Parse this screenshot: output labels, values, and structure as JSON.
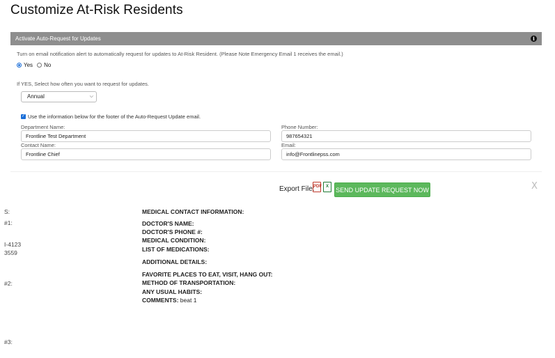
{
  "page": {
    "title": "Customize At-Risk Residents"
  },
  "section": {
    "title": "Activate Auto-Request for Updates",
    "info_icon": "i"
  },
  "notice": "Turn on email notification alert to automatically request for updates to At-Risk Resident. (Please Note Emergency Email 1 receives the email.)",
  "radio": {
    "yes": "Yes",
    "no": "No",
    "selected": "Yes"
  },
  "frequency": {
    "label": "If YES, Select how often you want to request for updates.",
    "selected": "Annual"
  },
  "footer_option": {
    "label": "Use the information below for the footer of the Auto-Request Update email.",
    "checked": true
  },
  "fields": {
    "department_label": "Department Name:",
    "department_value": "Frontline Test Department",
    "phone_label": "Phone Number:",
    "phone_value": "987654321",
    "contact_label": "Contact Name:",
    "contact_value": "Frontline Chief",
    "email_label": "Email:",
    "email_value": "info@Frontlinepss.com"
  },
  "export": {
    "label": "Export File:",
    "pdf": "PDF",
    "xls": "X",
    "send_button": "SEND UPDATE REQUEST NOW",
    "close": "X"
  },
  "left_fragments": [
    "S:",
    "#1:",
    "I-4123",
    "3559",
    "#2:",
    "#3:"
  ],
  "medical": {
    "header": "MEDICAL CONTACT INFORMATION:",
    "doctor_name": "DOCTOR'S NAME:",
    "doctor_phone": "DOCTOR'S PHONE #:",
    "condition": "MEDICAL CONDITION:",
    "medications": "LIST OF MEDICATIONS:",
    "additional": "ADDITIONAL DETAILS:",
    "favorite_places": "FAVORITE PLACES TO EAT, VISIT, HANG OUT:",
    "transport": "METHOD OF TRANSPORTATION:",
    "habits": "ANY USUAL HABITS:",
    "comments_label": "COMMENTS:",
    "comments_value": "beat 1"
  }
}
